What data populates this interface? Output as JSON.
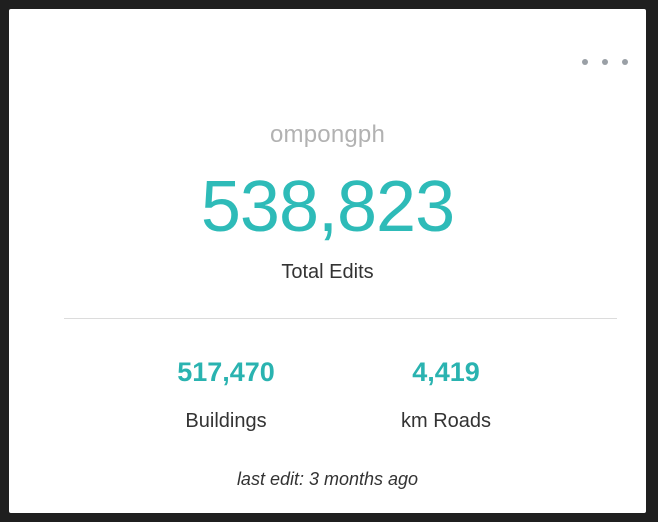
{
  "card": {
    "username": "ompongph",
    "total": {
      "value": "538,823",
      "label": "Total Edits"
    },
    "stats": [
      {
        "value": "517,470",
        "label": "Buildings"
      },
      {
        "value": "4,419",
        "label": "km Roads"
      }
    ],
    "last_edit": "last edit: 3 months ago",
    "menu_icon": "more-horizontal-icon"
  },
  "colors": {
    "accent": "#2ebbb8",
    "muted": "#b2b2b2",
    "text": "#333333",
    "background": "#1f1f1f"
  }
}
